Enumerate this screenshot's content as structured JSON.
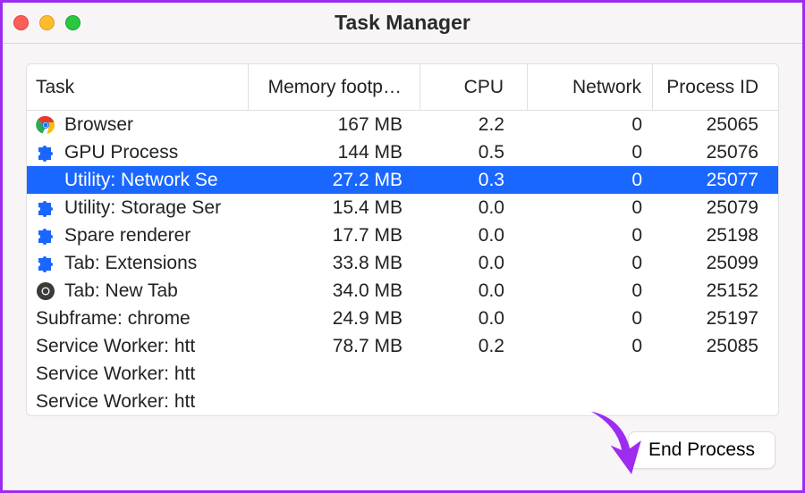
{
  "window": {
    "title": "Task Manager"
  },
  "columns": {
    "task": "Task",
    "memory": "Memory footp…",
    "cpu": "CPU",
    "network": "Network",
    "pid": "Process ID"
  },
  "rows": [
    {
      "icon": "chrome",
      "label": "Browser",
      "memory": "167 MB",
      "cpu": "2.2",
      "network": "0",
      "pid": "25065",
      "level": 0,
      "selected": false
    },
    {
      "icon": "puzzle",
      "label": "GPU Process",
      "memory": "144 MB",
      "cpu": "0.5",
      "network": "0",
      "pid": "25076",
      "level": 0,
      "selected": false
    },
    {
      "icon": "puzzle",
      "label": "Utility: Network Se",
      "memory": "27.2 MB",
      "cpu": "0.3",
      "network": "0",
      "pid": "25077",
      "level": 0,
      "selected": true
    },
    {
      "icon": "puzzle",
      "label": "Utility: Storage Ser",
      "memory": "15.4 MB",
      "cpu": "0.0",
      "network": "0",
      "pid": "25079",
      "level": 0,
      "selected": false
    },
    {
      "icon": "puzzle",
      "label": "Spare renderer",
      "memory": "17.7 MB",
      "cpu": "0.0",
      "network": "0",
      "pid": "25198",
      "level": 0,
      "selected": false
    },
    {
      "icon": "puzzle",
      "label": "Tab: Extensions",
      "memory": "33.8 MB",
      "cpu": "0.0",
      "network": "0",
      "pid": "25099",
      "level": 0,
      "selected": false
    },
    {
      "icon": "chrome-dark",
      "label": "Tab: New Tab",
      "memory": "34.0 MB",
      "cpu": "0.0",
      "network": "0",
      "pid": "25152",
      "level": 0,
      "selected": false
    },
    {
      "icon": "",
      "label": "Subframe: chrome",
      "memory": "24.9 MB",
      "cpu": "0.0",
      "network": "0",
      "pid": "25197",
      "level": 1,
      "selected": false
    },
    {
      "icon": "",
      "label": "Service Worker: htt",
      "memory": "78.7 MB",
      "cpu": "0.2",
      "network": "0",
      "pid": "25085",
      "level": 1,
      "selected": false
    },
    {
      "icon": "",
      "label": "Service Worker: htt",
      "memory": "",
      "cpu": "",
      "network": "",
      "pid": "",
      "level": 1,
      "selected": false
    },
    {
      "icon": "",
      "label": "Service Worker: htt",
      "memory": "",
      "cpu": "",
      "network": "",
      "pid": "",
      "level": 1,
      "selected": false
    }
  ],
  "actions": {
    "end_process": "End Process"
  }
}
